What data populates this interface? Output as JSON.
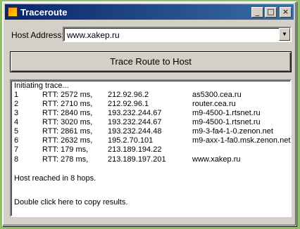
{
  "window": {
    "title": "Traceroute",
    "buttons": {
      "minimize": "_",
      "maximize": "□",
      "close": "×"
    }
  },
  "form": {
    "host_label": "Host Address:",
    "host_value": "www.xakep.ru",
    "trace_button": "Trace Route to Host"
  },
  "results": {
    "header": "Initiating trace...",
    "hops": [
      {
        "hop": "1",
        "rtt": "RTT: 2572 ms,",
        "ip": "212.92.96.2",
        "host": "as5300.cea.ru"
      },
      {
        "hop": "2",
        "rtt": "RTT: 2710 ms,",
        "ip": "212.92.96.1",
        "host": "router.cea.ru"
      },
      {
        "hop": "3",
        "rtt": "RTT: 2840 ms,",
        "ip": "193.232.244.67",
        "host": "m9-4500-1.rtsnet.ru"
      },
      {
        "hop": "4",
        "rtt": "RTT: 3020 ms,",
        "ip": "193.232.244.67",
        "host": "m9-4500-1.rtsnet.ru"
      },
      {
        "hop": "5",
        "rtt": "RTT: 2861 ms,",
        "ip": "193.232.244.48",
        "host": "m9-3-fa4-1-0.zenon.net"
      },
      {
        "hop": "6",
        "rtt": "RTT: 2632 ms,",
        "ip": "195.2.70.101",
        "host": "m9-axx-1-fa0.msk.zenon.net"
      },
      {
        "hop": "7",
        "rtt": "RTT: 179 ms,",
        "ip": "213.189.194.22",
        "host": ""
      },
      {
        "hop": "8",
        "rtt": "RTT: 278 ms,",
        "ip": "213.189.197.201",
        "host": "www.xakep.ru"
      }
    ],
    "summary": "Host reached in 8 hops.",
    "copy_hint": "Double click here to copy results."
  }
}
